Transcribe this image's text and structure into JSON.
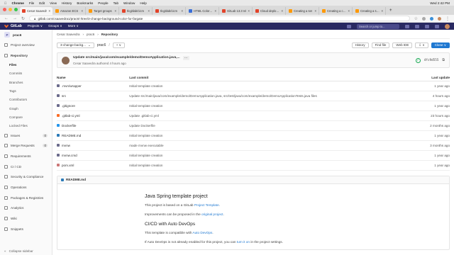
{
  "macbar": {
    "apple": "",
    "app": "Chrome",
    "menus": [
      "File",
      "Edit",
      "View",
      "History",
      "Bookmarks",
      "People",
      "Tab",
      "Window",
      "Help"
    ],
    "clock": "Wed 2:42 PM"
  },
  "tabs": [
    {
      "label": "Cesar Saavedr",
      "active": true
    },
    {
      "label": "Amazon ECS"
    },
    {
      "label": "Target groups"
    },
    {
      "label": "tlcgitlab/cicm"
    },
    {
      "label": "tlcgitlab/cicm"
    },
    {
      "label": "HTML Color Na"
    },
    {
      "label": "GitLab 13.3 rel"
    },
    {
      "label": "Cloud deploym"
    },
    {
      "label": "Creating a ser"
    },
    {
      "label": "Creating a clust"
    },
    {
      "label": "Creating a serv"
    }
  ],
  "address": {
    "url": "gitlab.com/csaavedra1/prac6/-/tree/3-change-background-color-for-fargate"
  },
  "gitlab": {
    "brand": "GitLab",
    "nav": [
      "Projects ∨",
      "Groups ∨",
      "More ∨"
    ],
    "search_placeholder": "Search or jump to..."
  },
  "sidebar": {
    "project": {
      "initial": "P",
      "name": "prac6"
    },
    "top": [
      {
        "label": "Project overview"
      }
    ],
    "repository": {
      "label": "Repository",
      "items": [
        "Files",
        "Commits",
        "Branches",
        "Tags",
        "Contributors",
        "Graph",
        "Compare",
        "Locked Files"
      ]
    },
    "items": [
      {
        "label": "Issues",
        "badge": "0"
      },
      {
        "label": "Merge Requests",
        "badge": "0"
      },
      {
        "label": "Requirements"
      },
      {
        "label": "CI / CD"
      },
      {
        "label": "Security & Compliance"
      },
      {
        "label": "Operations"
      },
      {
        "label": "Packages & Registries"
      },
      {
        "label": "Analytics"
      },
      {
        "label": "Wiki"
      },
      {
        "label": "Snippets"
      }
    ],
    "collapse": "Collapse sidebar"
  },
  "breadcrumb": [
    "Cesar Saavedra",
    "prac6",
    "Repository"
  ],
  "toolbar": {
    "branch": "3-change-backg...",
    "path": "prac6",
    "add": "+ ∨",
    "history": "History",
    "find_file": "Find file",
    "web_ide": "Web IDE",
    "download": "⇩ ∨",
    "clone": "Clone ∨"
  },
  "last_commit": {
    "message": "Update src/main/java/com/example/demo/DemoApplication.java,...",
    "more": "···",
    "author": "Cesar Saavedra",
    "authored": "authored 4 hours ago",
    "sha": "4fc9d555"
  },
  "table": {
    "headers": [
      "Name",
      "Last commit",
      "Last update"
    ],
    "rows": [
      {
        "name": ".mvn/wrapper",
        "commit": "Initial template creation",
        "updated": "1 year ago"
      },
      {
        "name": "src",
        "commit": "Update src/main/java/com/example/demo/DemoApplication.java, src/test/java/com/example/demo/DemoApplicationTests.java files",
        "updated": "4 hours ago"
      },
      {
        "name": ".gitignore",
        "commit": "Initial template creation",
        "updated": "1 year ago"
      },
      {
        "name": ".gitlab-ci.yml",
        "commit": "Update .gitlab-ci.yml",
        "updated": "23 hours ago"
      },
      {
        "name": "Dockerfile",
        "commit": "Update Dockerfile",
        "updated": "2 months ago"
      },
      {
        "name": "README.md",
        "commit": "Initial template creation",
        "updated": "1 year ago"
      },
      {
        "name": "mvnw",
        "commit": "made mvnw executable",
        "updated": "3 months ago"
      },
      {
        "name": "mvnw.cmd",
        "commit": "Initial template creation",
        "updated": "1 year ago"
      },
      {
        "name": "pom.xml",
        "commit": "Initial template creation",
        "updated": "1 year ago"
      }
    ]
  },
  "readme": {
    "filename": "README.md",
    "title": "Java Spring template project",
    "p1_pre": "This project is based on a GitLab ",
    "p1_link": "Project Template",
    "p1_post": ".",
    "p2_pre": "Improvements can be proposed in the ",
    "p2_link": "original project",
    "p2_post": ".",
    "h2": "CI/CD with Auto DevOps",
    "p3_pre": "This template is compatible with ",
    "p3_link": "Auto DevOps",
    "p3_post": ".",
    "p4_pre": "If Auto DevOps is not already enabled for this project, you can ",
    "p4_link": "turn it on",
    "p4_post": " in the project settings."
  },
  "colors": {
    "header": "#292961",
    "accent": "#1f78d1",
    "brand": "#fc6d26"
  }
}
